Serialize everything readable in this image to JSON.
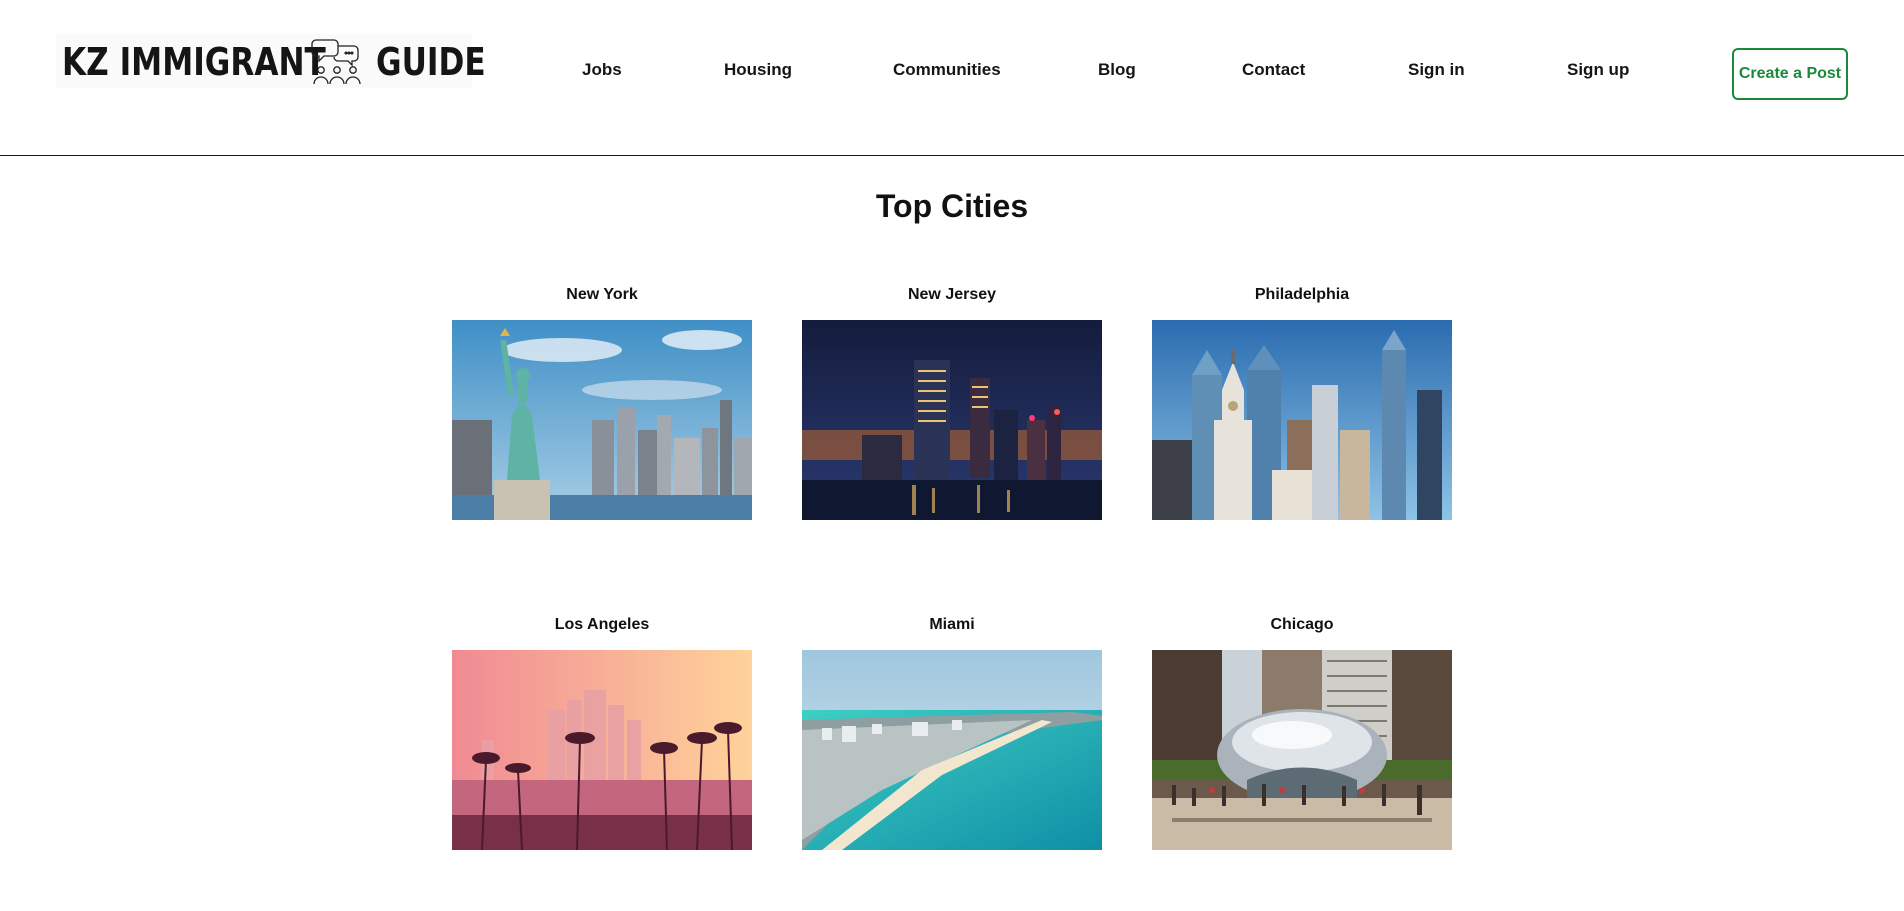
{
  "header": {
    "logo": {
      "text_left": "KZ IMMIGRANT",
      "text_right": "GUIDE",
      "icon": "chat-people-icon"
    },
    "nav": [
      {
        "label": "Jobs"
      },
      {
        "label": "Housing"
      },
      {
        "label": "Communities"
      },
      {
        "label": "Blog"
      },
      {
        "label": "Contact"
      },
      {
        "label": "Sign in"
      },
      {
        "label": "Sign up"
      }
    ],
    "cta": {
      "label": "Create a Post",
      "color": "#1a8a3a"
    }
  },
  "main": {
    "title": "Top Cities",
    "cities": [
      {
        "name": "New York"
      },
      {
        "name": "New Jersey"
      },
      {
        "name": "Philadelphia"
      },
      {
        "name": "Los Angeles"
      },
      {
        "name": "Miami"
      },
      {
        "name": "Chicago"
      }
    ]
  }
}
